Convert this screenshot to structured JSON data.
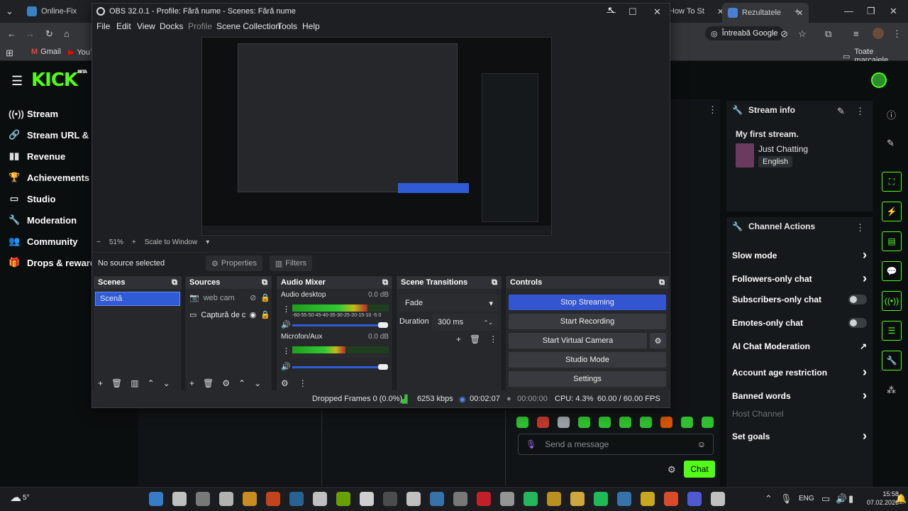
{
  "browser": {
    "tabs": [
      {
        "label": "Online-Fix",
        "color": "#3b82c4"
      },
      {
        "label": "How To St",
        "color": "#9aa0a6"
      },
      {
        "label": "Rezultatele",
        "color": "#4a7fd6"
      }
    ],
    "ask_google": "Întreabă Google",
    "bookmarks": [
      {
        "label": "Gmail"
      },
      {
        "label": "YouT"
      }
    ],
    "all_bookmarks": "Toate marcajele"
  },
  "kick": {
    "logo": "KICK",
    "beta": "BETA",
    "nav": [
      {
        "label": "Stream",
        "icon": "broadcast-icon"
      },
      {
        "label": "Stream URL & K",
        "icon": "link-icon"
      },
      {
        "label": "Revenue",
        "icon": "bars-icon"
      },
      {
        "label": "Achievements",
        "icon": "trophy-icon"
      },
      {
        "label": "Studio",
        "icon": "monitor-icon"
      },
      {
        "label": "Moderation",
        "icon": "wrench-icon"
      },
      {
        "label": "Community",
        "icon": "people-icon"
      },
      {
        "label": "Drops & rewards",
        "icon": "gift-icon"
      }
    ],
    "stream_info": {
      "heading": "Stream info",
      "title": "My first stream.",
      "category": "Just Chatting",
      "language": "English"
    },
    "channel_actions": {
      "heading": "Channel Actions",
      "items": [
        {
          "label": "Slow mode",
          "control": "arrow"
        },
        {
          "label": "Followers-only chat",
          "control": "arrow"
        },
        {
          "label": "Subscribers-only chat",
          "control": "toggle"
        },
        {
          "label": "Emotes-only chat",
          "control": "toggle"
        },
        {
          "label": "AI Chat Moderation",
          "control": "external"
        },
        {
          "label": "Account age restriction",
          "control": "arrow"
        },
        {
          "label": "Banned words",
          "control": "arrow"
        },
        {
          "label": "Host Channel",
          "control": "none"
        },
        {
          "label": "Set goals",
          "control": "arrow"
        }
      ]
    },
    "chat": {
      "placeholder": "Send a message",
      "send_label": "Chat"
    }
  },
  "obs": {
    "title": "OBS 32.0.1 - Profile: Fără nume - Scenes: Fără nume",
    "menu": [
      "File",
      "Edit",
      "View",
      "Docks",
      "Profile",
      "Scene Collection",
      "Tools",
      "Help"
    ],
    "zoom": "51%",
    "scale_label": "Scale to Window",
    "no_source": "No source selected",
    "properties": "Properties",
    "filters": "Filters",
    "scenes": {
      "heading": "Scenes",
      "items": [
        "Scenă"
      ]
    },
    "sources": {
      "heading": "Sources",
      "items": [
        "web cam",
        "Captură de c"
      ]
    },
    "mixer": {
      "heading": "Audio Mixer",
      "channels": [
        {
          "name": "Audio desktop",
          "db": "0.0 dB",
          "level": 0.78
        },
        {
          "name": "Microfon/Aux",
          "db": "0.0 dB",
          "level": 0.55
        }
      ],
      "scale": "-60-55-50-45-40-35-30-25-20-15-10 -5  0"
    },
    "transitions": {
      "heading": "Scene Transitions",
      "type": "Fade",
      "duration_label": "Duration",
      "duration": "300 ms"
    },
    "controls": {
      "heading": "Controls",
      "buttons": [
        "Stop Streaming",
        "Start Recording",
        "Start Virtual Camera",
        "Studio Mode",
        "Settings"
      ]
    },
    "status": {
      "dropped": "Dropped Frames 0 (0.0%)",
      "bitrate": "6253 kbps",
      "stream_time": "00:02:07",
      "rec_time": "00:00:00",
      "cpu": "CPU: 4.3%",
      "fps": "60.00 / 60.00 FPS"
    }
  },
  "taskbar": {
    "weather": "5°",
    "lang": "ENG",
    "time": "15:58",
    "date": "07.02.2026"
  }
}
